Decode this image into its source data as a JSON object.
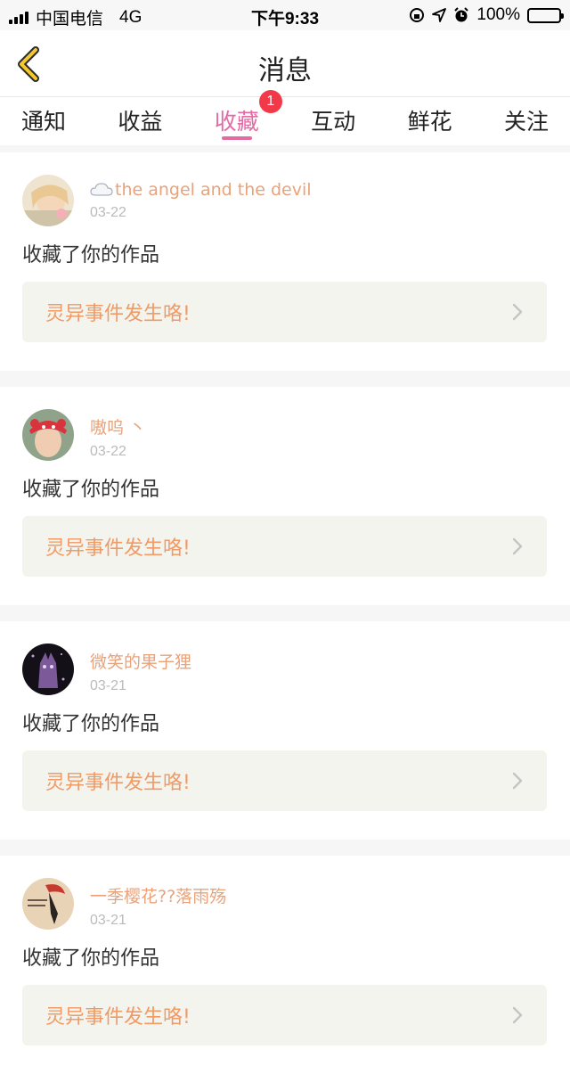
{
  "status_bar": {
    "carrier": "中国电信",
    "network": "4G",
    "time": "下午9:33",
    "battery": "100%",
    "battery_level": 1.0
  },
  "nav": {
    "title": "消息",
    "back_icon": "chevron-left-icon"
  },
  "tabs": [
    {
      "label": "通知"
    },
    {
      "label": "收益"
    },
    {
      "label": "收藏",
      "badge": "1",
      "active": true
    },
    {
      "label": "互动"
    },
    {
      "label": "鲜花"
    },
    {
      "label": "关注"
    }
  ],
  "colors": {
    "accent": "#e46aa4",
    "username": "#e9a27a",
    "work_title": "#f09a66",
    "badge": "#f2394a"
  },
  "items": [
    {
      "username": "the angel and the devil",
      "date": "03-22",
      "action": "收藏了你的作品",
      "work_title": "灵异事件发生咯!"
    },
    {
      "username": "嗷呜 丶",
      "date": "03-22",
      "action": "收藏了你的作品",
      "work_title": "灵异事件发生咯!"
    },
    {
      "username": "微笑的果子狸",
      "date": "03-21",
      "action": "收藏了你的作品",
      "work_title": "灵异事件发生咯!"
    },
    {
      "username": "一季樱花??落雨殇",
      "date": "03-21",
      "action": "收藏了你的作品",
      "work_title": "灵异事件发生咯!"
    }
  ]
}
